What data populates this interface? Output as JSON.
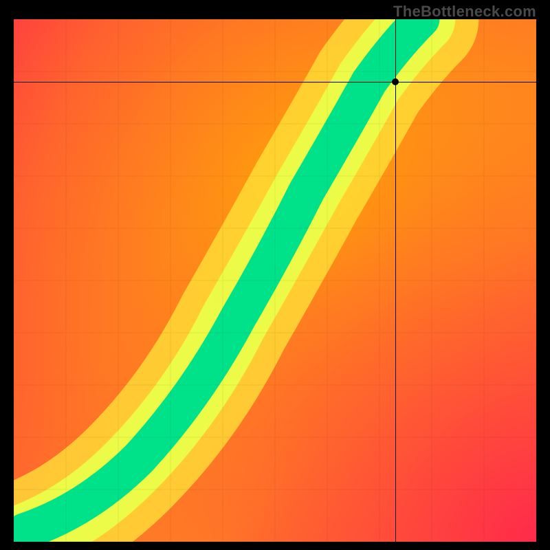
{
  "watermark": "TheBottleneck.com",
  "chart_data": {
    "type": "heatmap",
    "title": "",
    "xlabel": "",
    "ylabel": "",
    "xlim": [
      0,
      100
    ],
    "ylim": [
      0,
      100
    ],
    "grid": false,
    "legend": false,
    "color_scale": {
      "stops": [
        {
          "value": 0.0,
          "color": "#ff2b4a"
        },
        {
          "value": 0.25,
          "color": "#ff7a2a"
        },
        {
          "value": 0.5,
          "color": "#ffd400"
        },
        {
          "value": 0.75,
          "color": "#e8ff3a"
        },
        {
          "value": 1.0,
          "color": "#00e28a"
        }
      ],
      "meaning": "0 = worst match (red), 1 = ideal match (green)"
    },
    "optimal_band": {
      "description": "narrow high-value ridge curving from lower-left toward upper-center",
      "approx_points_xy": [
        [
          0,
          0
        ],
        [
          10,
          5
        ],
        [
          22,
          14
        ],
        [
          33,
          28
        ],
        [
          42,
          42
        ],
        [
          50,
          55
        ],
        [
          56,
          67
        ],
        [
          62,
          78
        ],
        [
          68,
          88
        ],
        [
          74,
          96
        ],
        [
          78,
          100
        ]
      ],
      "band_width_approx": 8
    },
    "crosshair": {
      "x": 73,
      "y": 88
    },
    "marker": {
      "x": 73,
      "y": 88
    }
  },
  "colors": {
    "background": "#000000",
    "watermark": "#4a4a4a"
  }
}
